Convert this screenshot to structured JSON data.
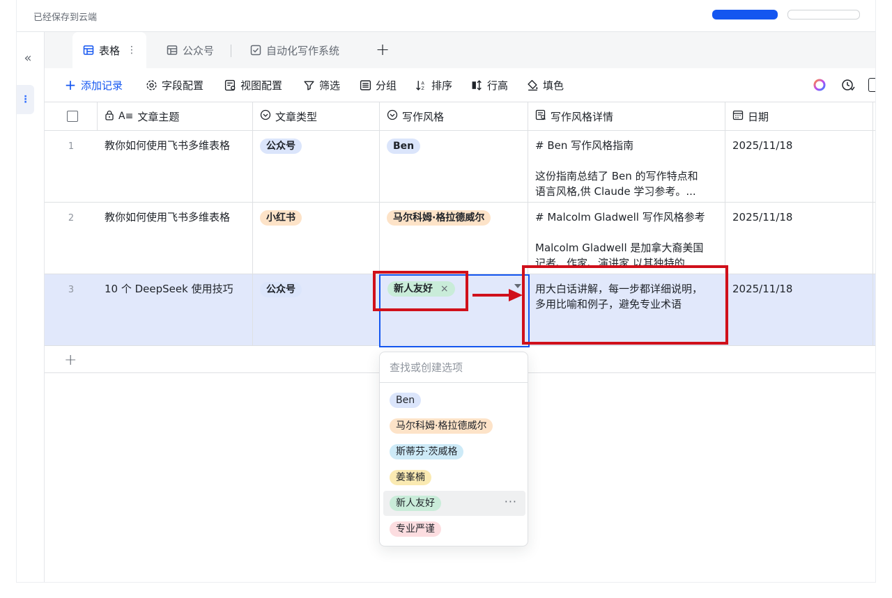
{
  "header": {
    "saved_status": "已经保存到云端"
  },
  "tabs": [
    {
      "label": "表格",
      "icon": "table-icon"
    },
    {
      "label": "公众号",
      "icon": "table-icon"
    },
    {
      "label": "自动化写作系统",
      "icon": "checkbox-icon"
    }
  ],
  "toolbar": {
    "add_record": "添加记录",
    "field_config": "字段配置",
    "view_config": "视图配置",
    "filter": "筛选",
    "group": "分组",
    "sort": "排序",
    "row_height": "行高",
    "fill_color": "填色"
  },
  "columns": [
    "文章主题",
    "文章类型",
    "写作风格",
    "写作风格详情",
    "日期"
  ],
  "rows": [
    {
      "num": "1",
      "topic": "教你如何使用飞书多维表格",
      "type": "公众号",
      "style": "Ben",
      "detail_line1": "# Ben 写作风格指南",
      "detail_line2": "这份指南总结了 Ben 的写作特点和",
      "detail_line3": "语言风格,供 Claude 学习参考。...",
      "date": "2025/11/18"
    },
    {
      "num": "2",
      "topic": "教你如何使用飞书多维表格",
      "type": "小红书",
      "style": "马尔科姆·格拉德威尔",
      "detail_line1": "# Malcolm Gladwell 写作风格参考",
      "detail_line2": "Malcolm Gladwell 是加拿大裔美国",
      "detail_line3": "记者、作家、演讲家,以其独特的...",
      "date": "2025/11/18"
    },
    {
      "num": "3",
      "topic": "10 个 DeepSeek 使用技巧",
      "type": "公众号",
      "style": "新人友好",
      "detail_line1": "用大白话讲解，每一步都详细说明，",
      "detail_line2": "多用比喻和例子，避免专业术语",
      "date": "2025/11/18"
    }
  ],
  "dropdown": {
    "placeholder": "查找或创建选项",
    "options": [
      "Ben",
      "马尔科姆·格拉德威尔",
      "斯蒂芬·茨威格",
      "姜峯楠",
      "新人友好",
      "专业严谨"
    ]
  },
  "colors": {
    "accent": "#1456f0",
    "selected_row": "#e1e8fb",
    "annotation_red": "#d0101b",
    "tag_blue": "#dbe5fb",
    "tag_orange": "#fde3c8",
    "tag_cyan": "#cdeaf7",
    "tag_yellow": "#faeab2",
    "tag_green": "#c9ecd9",
    "tag_pink": "#fcdde0"
  }
}
